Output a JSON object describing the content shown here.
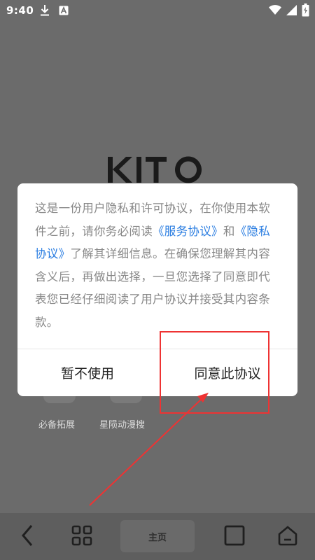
{
  "status_bar": {
    "time": "9:40",
    "icons": [
      "download-icon",
      "a-notification-icon",
      "wifi-icon",
      "signal-icon",
      "battery-icon"
    ]
  },
  "logo": {
    "text": "KITO"
  },
  "background_tiles": [
    {
      "label": "必备拓展"
    },
    {
      "label": "星陨动漫搜"
    }
  ],
  "dialog": {
    "message_parts": {
      "part1": "这是一份用户隐私和许可协议，在你使用本软件之前，请你务必阅读",
      "service_link": "《服务协议》",
      "and": "和",
      "privacy_link": "《隐私协议》",
      "part2": "了解其详细信息。在确保您理解其内容含义后，再做出选择，一旦您选择了同意即代表您已经仔细阅读了用户协议并接受其内容条款。"
    },
    "decline_label": "暂不使用",
    "agree_label": "同意此协议"
  },
  "bottom_nav": {
    "home_label": "主页",
    "icons": [
      "back-icon",
      "grid-icon",
      "tabs-icon",
      "home-icon"
    ]
  },
  "colors": {
    "overlay": "#6b6b6b",
    "link": "#2a7de1",
    "annotation": "#e33333"
  }
}
